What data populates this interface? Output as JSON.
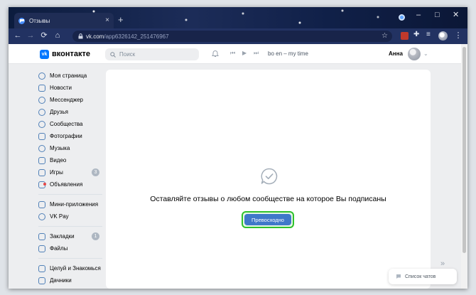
{
  "browser": {
    "tab_title": "Отзывы",
    "tab_close": "×",
    "new_tab": "+",
    "url_host": "vk.com",
    "url_path": "/app6326142_251476967",
    "window_controls": [
      "–",
      "□",
      "✕"
    ]
  },
  "header": {
    "brand": "вконтакте",
    "logo_text": "vk",
    "search_placeholder": "Поиск",
    "player_track": "bo en – my time",
    "user_name": "Анна"
  },
  "menu": {
    "group1": [
      {
        "label": "Моя страница",
        "icon": "user-circle-icon"
      },
      {
        "label": "Новости",
        "icon": "newspaper-icon"
      },
      {
        "label": "Мессенджер",
        "icon": "message-bubble-icon"
      },
      {
        "label": "Друзья",
        "icon": "friends-icon"
      },
      {
        "label": "Сообщества",
        "icon": "groups-icon"
      },
      {
        "label": "Фотографии",
        "icon": "photo-icon"
      },
      {
        "label": "Музыка",
        "icon": "music-note-icon"
      },
      {
        "label": "Видео",
        "icon": "video-icon"
      },
      {
        "label": "Игры",
        "icon": "gamepad-icon",
        "badge": "3"
      },
      {
        "label": "Объявления",
        "icon": "classifieds-icon"
      }
    ],
    "group2": [
      {
        "label": "Мини-приложения",
        "icon": "apps-icon"
      },
      {
        "label": "VK Pay",
        "icon": "vkpay-icon"
      }
    ],
    "group3": [
      {
        "label": "Закладки",
        "icon": "star-icon",
        "badge": "1"
      },
      {
        "label": "Файлы",
        "icon": "file-icon"
      }
    ],
    "group4": [
      {
        "label": "Целуй и Знакомься",
        "icon": "app-icon"
      },
      {
        "label": "Дачники",
        "icon": "app-icon"
      }
    ]
  },
  "content": {
    "message": "Оставляйте отзывы о любом сообществе на которое Вы подписаны",
    "cta_label": "Превосходно"
  },
  "chat": {
    "label": "Список чатов",
    "collapse": "»"
  },
  "colors": {
    "vk_blue": "#0077ff",
    "accent": "#5181b8",
    "cta_bg": "#3f78c9",
    "highlight": "#2fc12c"
  }
}
